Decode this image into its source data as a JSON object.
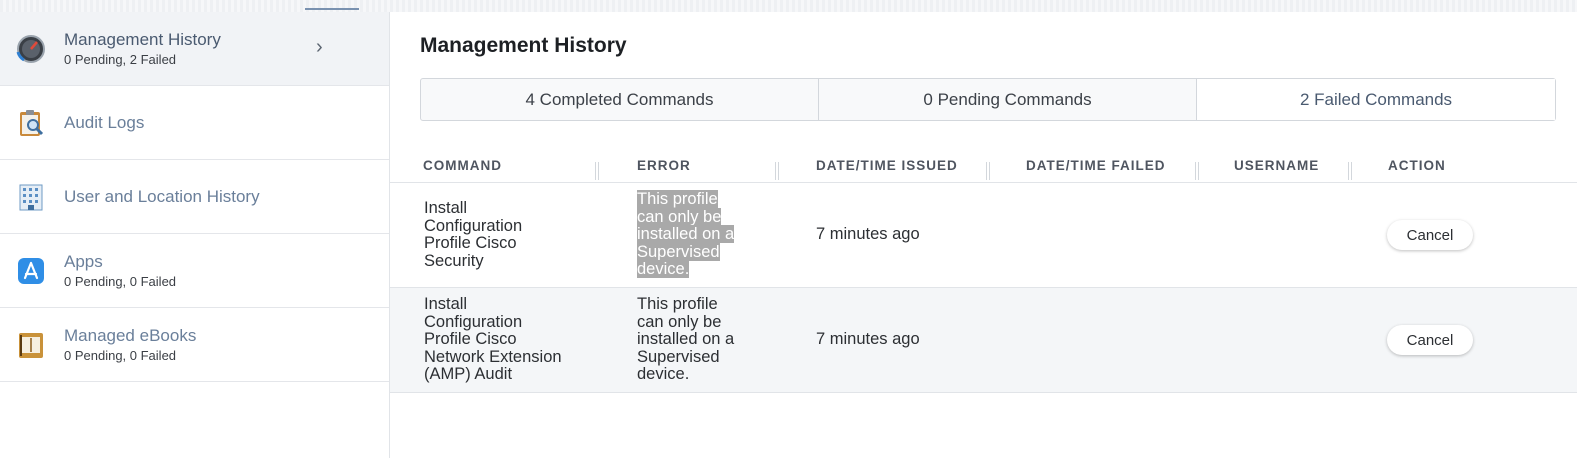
{
  "sidebar": {
    "items": [
      {
        "title": "Management History",
        "subtitle": "0 Pending, 2 Failed",
        "icon": "gauge-icon",
        "active": true
      },
      {
        "title": "Audit Logs",
        "subtitle": "",
        "icon": "clipboard-search-icon"
      },
      {
        "title": "User and Location History",
        "subtitle": "",
        "icon": "building-icon"
      },
      {
        "title": "Apps",
        "subtitle": "0 Pending, 0 Failed",
        "icon": "app-store-icon"
      },
      {
        "title": "Managed eBooks",
        "subtitle": "0 Pending, 0 Failed",
        "icon": "book-icon"
      }
    ]
  },
  "main": {
    "title": "Management History",
    "tabs": [
      {
        "label": "4 Completed Commands"
      },
      {
        "label": "0 Pending Commands"
      },
      {
        "label": "2 Failed Commands"
      }
    ],
    "columns": [
      "COMMAND",
      "ERROR",
      "DATE/TIME ISSUED",
      "DATE/TIME FAILED",
      "USERNAME",
      "ACTION"
    ],
    "rows": [
      {
        "command": [
          "Install",
          "Configuration",
          "Profile Cisco",
          "Security"
        ],
        "error": [
          "This profile",
          "can only be",
          "installed on a",
          "Supervised",
          "device."
        ],
        "issued": "7 minutes ago",
        "failed": "",
        "username": "",
        "action": "Cancel"
      },
      {
        "command": [
          "Install",
          "Configuration",
          "Profile Cisco",
          "Network Extension",
          "(AMP) Audit"
        ],
        "error": [
          "This profile",
          "can only be",
          "installed on a",
          "Supervised",
          "device."
        ],
        "issued": "7 minutes ago",
        "failed": "",
        "username": "",
        "action": "Cancel"
      }
    ]
  },
  "colors": {
    "accent": "#6a7f9a",
    "highlight": "#a9a9a9",
    "active_bg": "#f1f3f6"
  }
}
